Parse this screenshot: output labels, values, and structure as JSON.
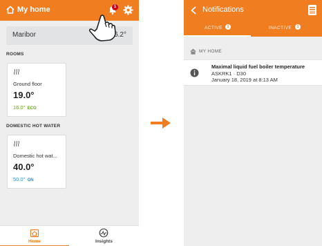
{
  "home_screen": {
    "title": "My home",
    "notification_badge": "1",
    "weather": {
      "city": "Maribor",
      "temperature": "6.2°"
    },
    "rooms_label": "ROOMS",
    "rooms": [
      {
        "name": "Ground floor",
        "temperature": "19.0°",
        "setpoint": "16.0°",
        "mode": "ECO"
      }
    ],
    "dhw_label": "DOMESTIC HOT WATER",
    "dhw": [
      {
        "name": "Domestic hot wat...",
        "temperature": "40.0°",
        "setpoint": "50.0°",
        "mode": "ON"
      }
    ],
    "nav": {
      "home": "Home",
      "insights": "Insights"
    }
  },
  "notifications_screen": {
    "title": "Notifications",
    "tabs": {
      "active": "ACTIVE",
      "active_count": "1",
      "inactive": "INACTIVE",
      "inactive_count": "1"
    },
    "group_label": "MY HOME",
    "items": [
      {
        "title": "Maximal liquid fuel boiler temperature",
        "code": "ASKRK1 · D30",
        "time": "January 18, 2019 at 8:13 AM"
      }
    ]
  },
  "colors": {
    "accent": "#f07d20",
    "background": "#eeeeee",
    "eco_green": "#6a9e1f",
    "on_blue": "#2a8fd4",
    "badge_red": "#d0021b"
  },
  "icons": [
    "home-icon",
    "bell-icon",
    "gear-icon",
    "heat-icon",
    "hand-pointer-icon",
    "insights-icon",
    "back-arrow-icon",
    "mailbox-icon",
    "info-icon",
    "arrow-right-icon"
  ]
}
